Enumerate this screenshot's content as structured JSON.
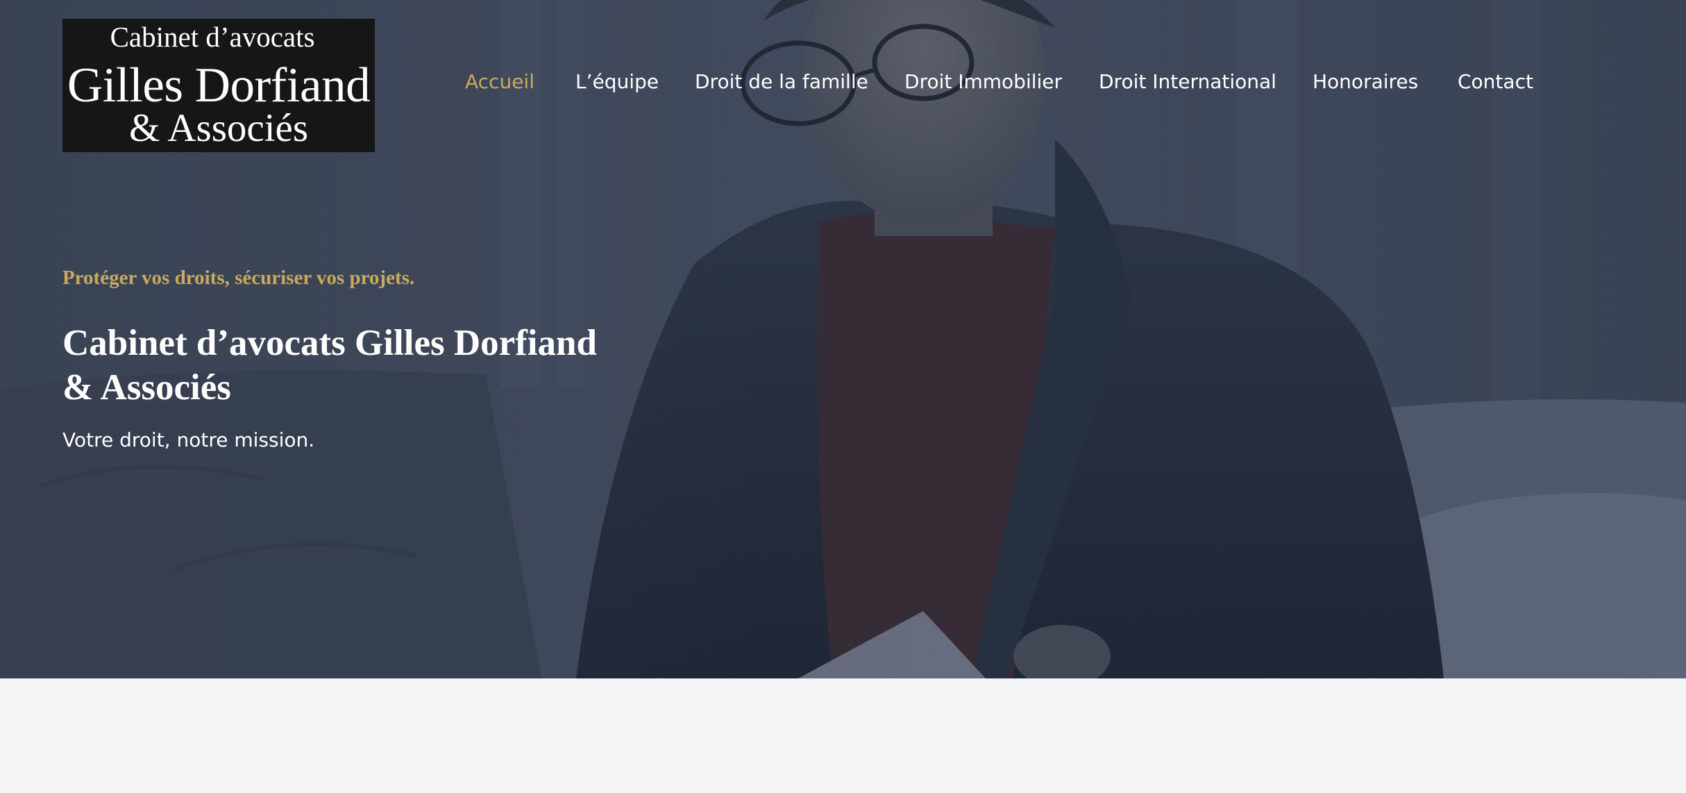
{
  "logo": {
    "line1": "Cabinet d’avocats",
    "line2": "Gilles Dorfiand",
    "line3": "& Associés"
  },
  "nav": {
    "items": [
      {
        "label": "Accueil",
        "active": true
      },
      {
        "label": "L’équipe",
        "active": false
      },
      {
        "label": "Droit de la famille",
        "active": false
      },
      {
        "label": "Droit Immobilier",
        "active": false
      },
      {
        "label": "Droit International",
        "active": false
      },
      {
        "label": "Honoraires",
        "active": false
      },
      {
        "label": "Contact",
        "active": false
      }
    ]
  },
  "hero": {
    "tagline": "Protéger vos droits, sécuriser vos projets.",
    "headline": "Cabinet d’avocats Gilles Dorfiand & Associés",
    "subline": "Votre droit, notre mission."
  },
  "colors": {
    "accent": "#c9a95d",
    "hero_overlay": "#3a4356",
    "logo_background": "#161616",
    "page_background": "#f4f5f7"
  }
}
